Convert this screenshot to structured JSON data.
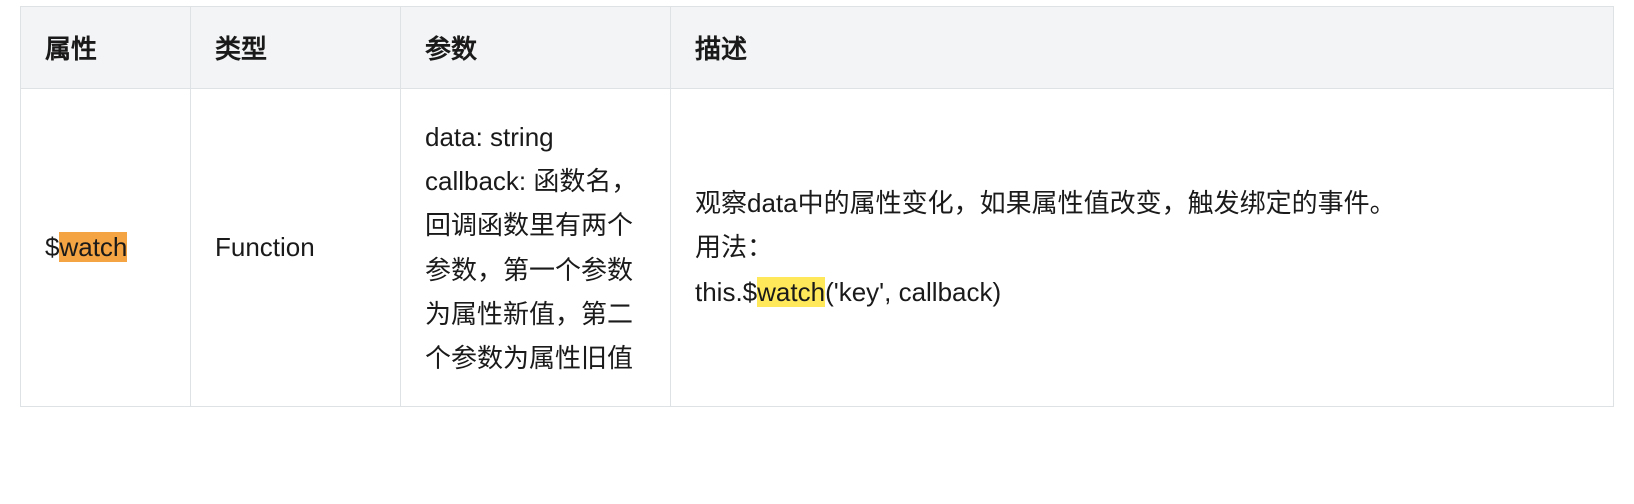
{
  "headers": {
    "attr": "属性",
    "type": "类型",
    "param": "参数",
    "desc": "描述"
  },
  "row": {
    "attr_prefix": "$",
    "attr_highlight": "watch",
    "type": "Function",
    "param": "data: string callback: 函数名，回调函数里有两个参数，第一个参数为属性新值，第二个参数为属性旧值",
    "desc_line1": "观察data中的属性变化，如果属性值改变，触发绑定的事件。",
    "desc_line2": "用法：",
    "desc_line3_prefix": "this.$",
    "desc_line3_highlight": "watch",
    "desc_line3_suffix": "('key', callback)"
  }
}
